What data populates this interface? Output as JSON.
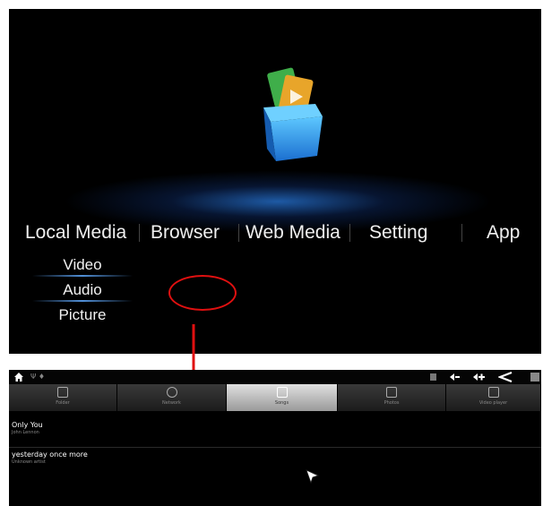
{
  "top_screen": {
    "main_menu": [
      "Local Media",
      "Browser",
      "Web Media",
      "Setting",
      "App"
    ],
    "submenu": [
      "Video",
      "Audio",
      "Picture"
    ],
    "logo_icon": "media-box-icon"
  },
  "bottom_screen": {
    "status_bar": {
      "home_icon": "home-icon",
      "left_glyphs": "Ψ ♦",
      "right_icons": [
        "menu-icon",
        "volume-down-icon",
        "volume-up-icon",
        "back-icon",
        "screenshot-icon"
      ]
    },
    "tabs": [
      {
        "label": "Folder",
        "icon": "folder-icon",
        "active": false
      },
      {
        "label": "Network",
        "icon": "network-icon",
        "active": false
      },
      {
        "label": "Songs",
        "icon": "music-icon",
        "active": true
      },
      {
        "label": "Photos",
        "icon": "photo-icon",
        "active": false
      },
      {
        "label": "Video player",
        "icon": "video-icon",
        "active": false
      }
    ],
    "songs": [
      {
        "title": "Only You",
        "artist": "John Lennon"
      },
      {
        "title": "yesterday once more",
        "artist": "Unknown artist"
      }
    ]
  },
  "annotation": {
    "color": "#e01010"
  },
  "colors": {
    "accent": "#2f7be0",
    "background": "#000000"
  }
}
